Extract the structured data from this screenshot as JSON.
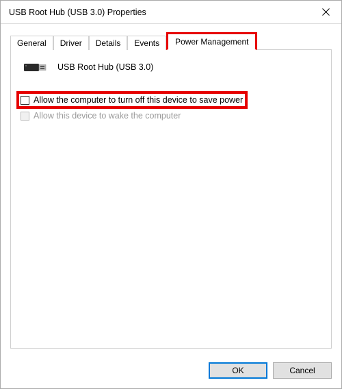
{
  "window": {
    "title": "USB Root Hub (USB 3.0) Properties"
  },
  "tabs": [
    {
      "label": "General"
    },
    {
      "label": "Driver"
    },
    {
      "label": "Details"
    },
    {
      "label": "Events"
    },
    {
      "label": "Power Management"
    }
  ],
  "device": {
    "name": "USB Root Hub (USB 3.0)"
  },
  "options": {
    "turn_off_label": "Allow the computer to turn off this device to save power",
    "wake_label": "Allow this device to wake the computer"
  },
  "buttons": {
    "ok": "OK",
    "cancel": "Cancel"
  }
}
